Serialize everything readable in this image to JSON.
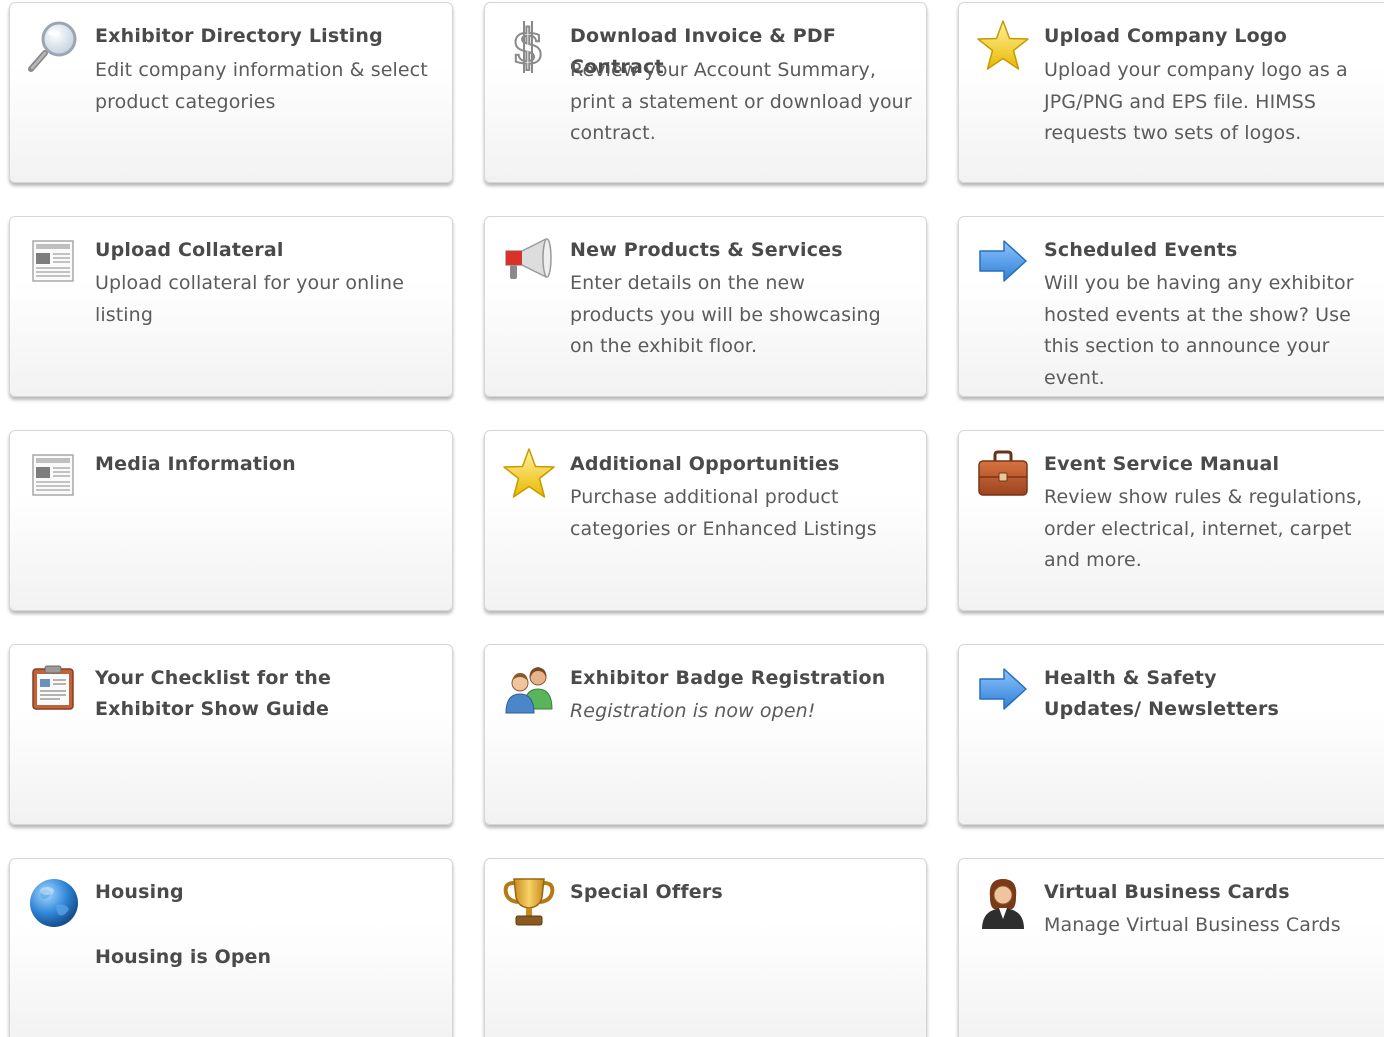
{
  "cards": [
    {
      "title": "Exhibitor Directory Listing",
      "desc": "Edit company information & select product categories",
      "icon": "magnifier-icon"
    },
    {
      "title": "Download Invoice & PDF Contract",
      "desc": "Review your Account Summary, print a statement or download your contract.",
      "icon": "dollar-sign-icon"
    },
    {
      "title": "Upload Company Logo",
      "desc": "Upload your company logo as a JPG/PNG and EPS file. HIMSS requests two sets of logos.",
      "icon": "star-icon"
    },
    {
      "title": "Upload Collateral",
      "desc": "Upload collateral for your online listing",
      "icon": "newspaper-icon"
    },
    {
      "title": "New Products & Services",
      "desc": "Enter details on the new products you will be showcasing on the exhibit floor.",
      "icon": "megaphone-icon"
    },
    {
      "title": "Scheduled Events",
      "desc": "Will you be having any exhibitor hosted events at the show? Use this section to announce your event.",
      "icon": "arrow-right-icon"
    },
    {
      "title": "Media Information",
      "desc": "",
      "icon": "newspaper-icon"
    },
    {
      "title": "Additional Opportunities",
      "desc": "Purchase additional product categories or Enhanced Listings",
      "icon": "star-icon"
    },
    {
      "title": "Event Service Manual",
      "desc": "Review show rules & regulations, order electrical, internet, carpet and more.",
      "icon": "briefcase-icon"
    },
    {
      "title": "Your Checklist for the Exhibitor Show Guide",
      "desc": "",
      "icon": "clipboard-icon"
    },
    {
      "title": "Exhibitor Badge Registration",
      "desc": "Registration is now open!",
      "icon": "users-icon"
    },
    {
      "title": "Health & Safety Updates/ Newsletters",
      "desc": "",
      "icon": "arrow-right-icon"
    },
    {
      "title": "Housing",
      "desc": "Housing is Open",
      "icon": "globe-icon"
    },
    {
      "title": "Special Offers",
      "desc": "",
      "icon": "trophy-icon"
    },
    {
      "title": "Virtual Business Cards",
      "desc": "Manage Virtual Business Cards",
      "icon": "person-icon"
    }
  ],
  "colors": {
    "arrow": "#3d8fe0",
    "star": "#f2c200",
    "briefcase": "#b5572b",
    "title_text": "#4a4a4a",
    "body_text": "#5b5b5b"
  }
}
